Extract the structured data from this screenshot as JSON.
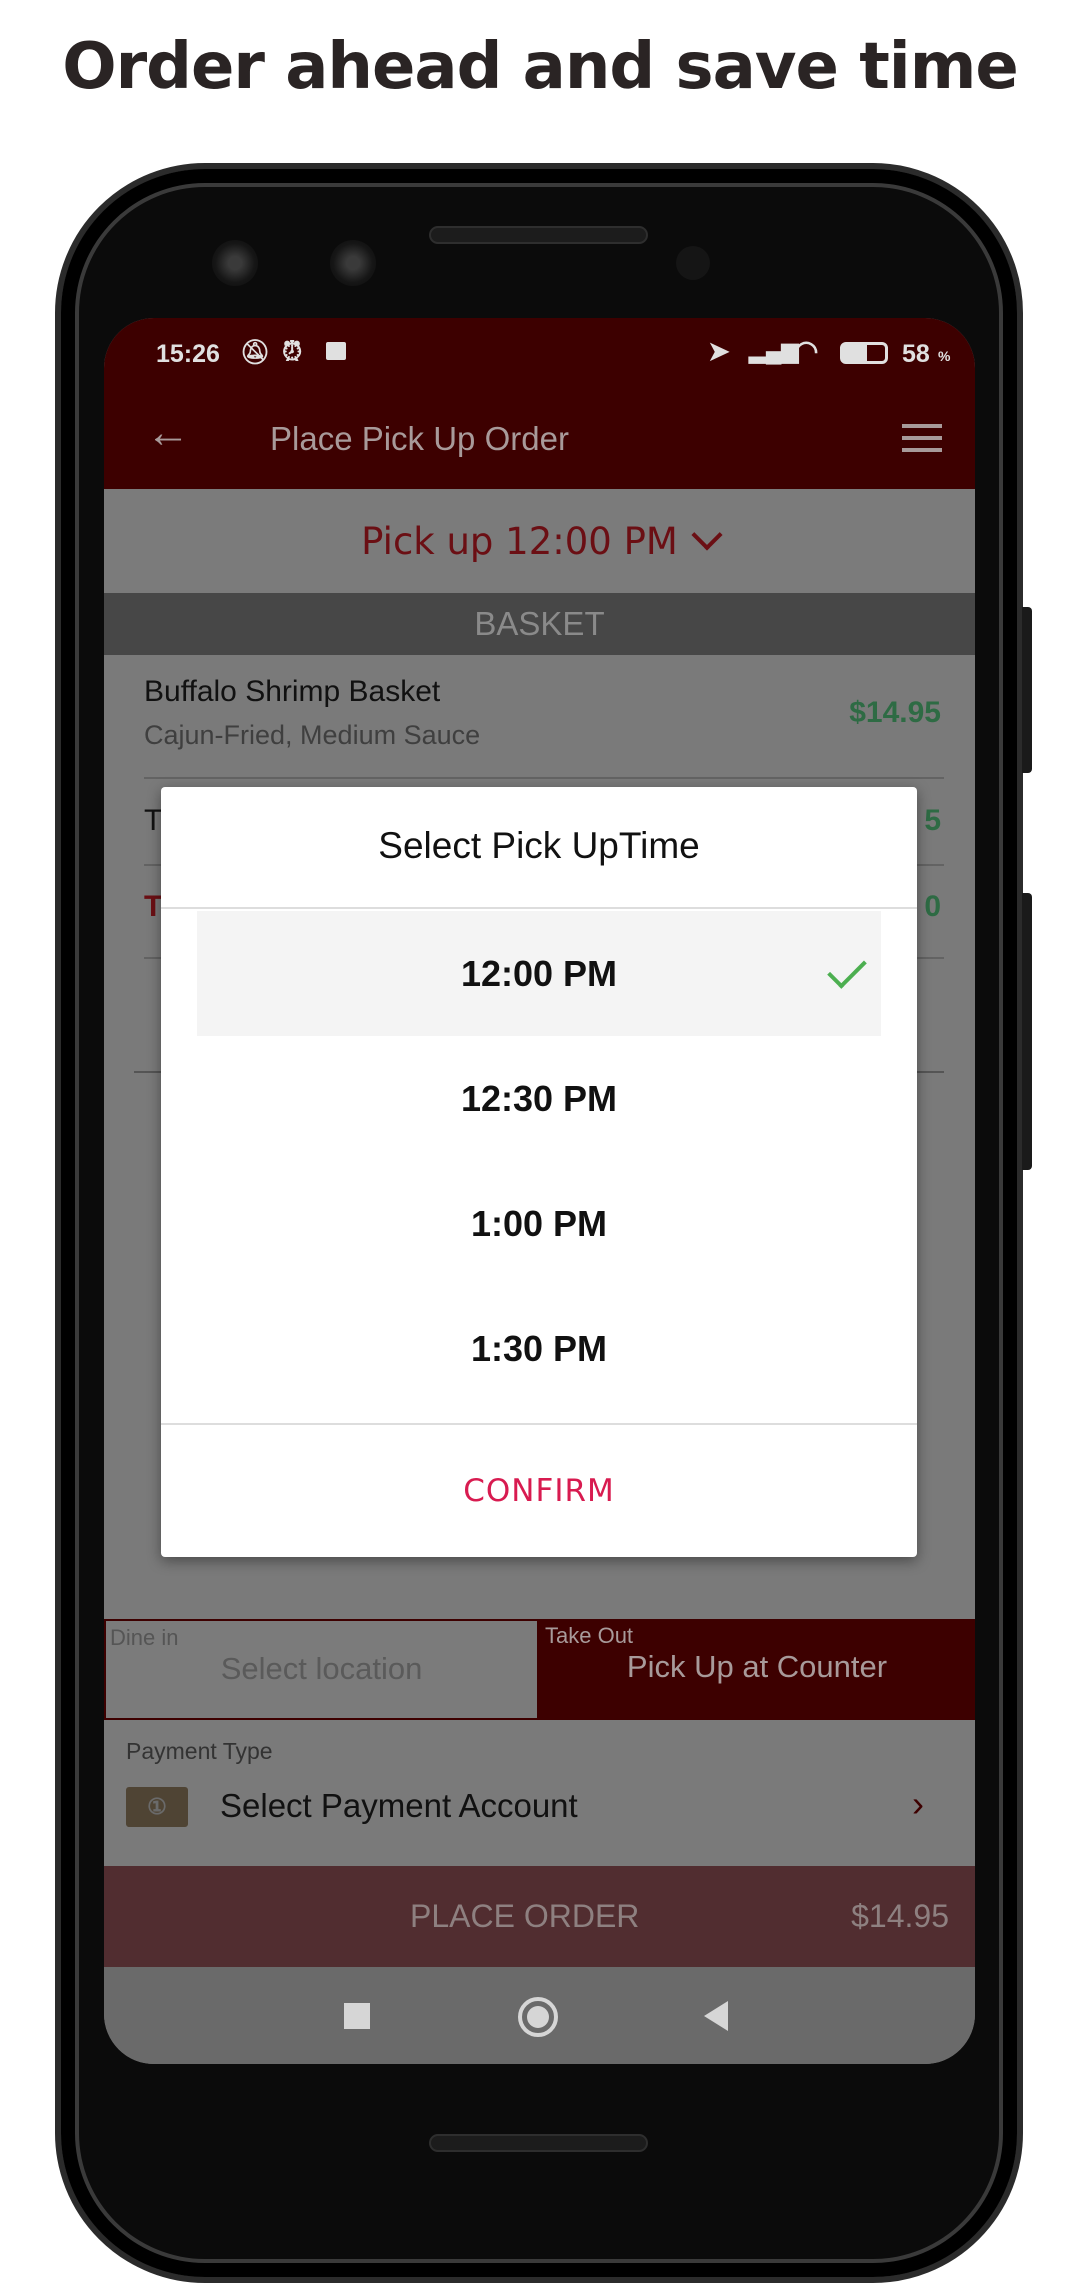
{
  "headline": "Order ahead and save time",
  "status_bar": {
    "time": "15:26",
    "battery": "58",
    "battery_unit": "%",
    "icons": [
      "mute-icon",
      "alarm-icon",
      "notification-icon",
      "location-icon",
      "signal-icon",
      "wifi-icon",
      "battery-icon"
    ]
  },
  "app_bar": {
    "title": "Place Pick Up Order",
    "back_icon": "arrow-left-icon",
    "menu_icon": "hamburger-icon"
  },
  "pickup": {
    "label": "Pick up 12:00 PM"
  },
  "basket": {
    "header": "BASKET",
    "items": [
      {
        "name": "Buffalo Shrimp Basket",
        "options": "Cajun-Fried, Medium Sauce",
        "price": "$14.95"
      }
    ],
    "partial_rows": [
      {
        "left": "T",
        "right": "5"
      },
      {
        "left": "T",
        "right": "0"
      }
    ]
  },
  "dialog": {
    "title": "Select Pick UpTime",
    "times": [
      "12:00 PM",
      "12:30 PM",
      "1:00 PM",
      "1:30 PM"
    ],
    "selected": "12:00 PM",
    "confirm": "CONFIRM"
  },
  "order_mode": {
    "dine_in_label": "Dine in",
    "dine_in_value": "Select location",
    "take_out_label": "Take Out",
    "take_out_value": "Pick Up at Counter",
    "selected": "Take Out"
  },
  "payment": {
    "label": "Payment Type",
    "value": "Select Payment Account"
  },
  "place_order": {
    "label": "PLACE ORDER",
    "total": "$14.95"
  },
  "colors": {
    "brand": "#3d0000",
    "accent": "#d81b50",
    "price": "#2e7d4a",
    "check": "#4caf50"
  }
}
